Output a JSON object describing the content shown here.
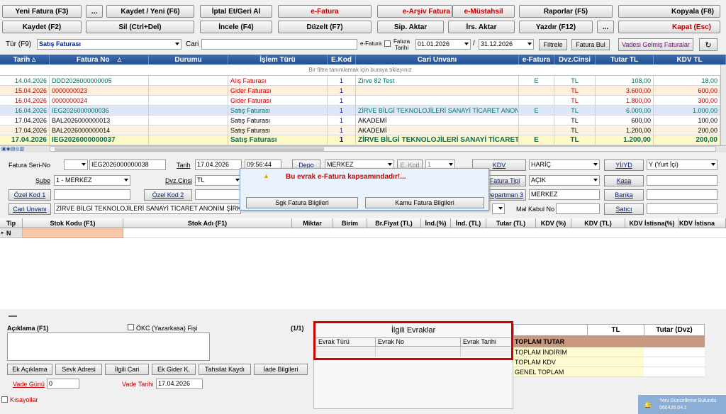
{
  "toolbar": {
    "row1": [
      "Yeni Fatura (F3)",
      "...",
      "Kaydet / Yeni (F6)",
      "İptal Et/Geri Al",
      "e-Fatura",
      "e-Arşiv Fatura",
      "e-Müstahsil",
      "Raporlar (F5)",
      "Kopyala (F8)"
    ],
    "row2": [
      "Kaydet (F2)",
      "Sil (Ctrl+Del)",
      "İncele (F4)",
      "Düzelt (F7)",
      "Sip. Aktar",
      "İrs. Aktar",
      "Yazdır (F12)",
      "...",
      "Kapat (Esc)"
    ]
  },
  "filter": {
    "tur_label": "Tür (F9)",
    "tur_value": "Satış Faturası",
    "cari_label": "Cari",
    "efatura_label": "e-Fatura",
    "fatura_tarihi_label_1": "Fatura",
    "fatura_tarihi_label_2": "Tarihi",
    "date_from": "01.01.2026",
    "sep": "/",
    "date_to": "31.12.2026",
    "filtrele": "Filtrele",
    "fatura_bul": "Fatura Bul",
    "vadesi_gelmis": "Vadesi Gelmiş Faturalar",
    "refresh": "↻"
  },
  "grid": {
    "headers": [
      "Tarih",
      "Fatura No",
      "Durumu",
      "İşlem Türü",
      "E.Kod",
      "Cari Unvanı",
      "e-Fatura",
      "Dvz.Cinsi",
      "Tutar TL",
      "KDV TL"
    ],
    "filter_hint": "Bir filtre tanımlamak için buraya tıklayınız",
    "rows": [
      {
        "tarih": "14.04.2026",
        "no": "DDD2026000000005",
        "durum": "",
        "islem": "Alış Faturası",
        "ekod": "1",
        "cari": "Zirve 82 Test",
        "efat": "E",
        "dvz": "TL",
        "tutar": "108,00",
        "kdv": "18,00"
      },
      {
        "tarih": "15.04.2026",
        "no": "0000000023",
        "durum": "",
        "islem": "Gider Faturası",
        "ekod": "1",
        "cari": "",
        "efat": "",
        "dvz": "TL",
        "tutar": "3.600,00",
        "kdv": "600,00"
      },
      {
        "tarih": "16.04.2026",
        "no": "0000000024",
        "durum": "",
        "islem": "Gider Faturası",
        "ekod": "1",
        "cari": "",
        "efat": "",
        "dvz": "TL",
        "tutar": "1.800,00",
        "kdv": "300,00"
      },
      {
        "tarih": "16.04.2026",
        "no": "IEG2026000000036",
        "durum": "",
        "islem": "Satış Faturası",
        "ekod": "1",
        "cari": "ZİRVE BİLGİ TEKNOLOJİLERİ SANAYİ TİCARET ANONİM ŞİRKETİ",
        "efat": "E",
        "dvz": "TL",
        "tutar": "6.000,00",
        "kdv": "1.000,00"
      },
      {
        "tarih": "17.04.2026",
        "no": "BAL2026000000013",
        "durum": "",
        "islem": "Satış Faturası",
        "ekod": "1",
        "cari": "AKADEMİ",
        "efat": "",
        "dvz": "TL",
        "tutar": "600,00",
        "kdv": "100,00"
      },
      {
        "tarih": "17.04.2026",
        "no": "BAL2026000000014",
        "durum": "",
        "islem": "Satış Faturası",
        "ekod": "1",
        "cari": "AKADEMİ",
        "efat": "",
        "dvz": "TL",
        "tutar": "1.200,00",
        "kdv": "200,00"
      },
      {
        "tarih": "17.04.2026",
        "no": "IEG2026000000037",
        "durum": "",
        "islem": "Satış Faturası",
        "ekod": "1",
        "cari": "ZİRVE BİLGİ TEKNOLOJİLERİ SANAYİ TİCARET ANONİM ŞİRKETİ",
        "efat": "E",
        "dvz": "TL",
        "tutar": "1.200,00",
        "kdv": "200,00"
      }
    ]
  },
  "form": {
    "fatura_seri_no": "Fatura Seri-No",
    "seri": "",
    "no": "IEG2026000000038",
    "tarih_label": "Tarih",
    "tarih": "17.04.2026",
    "saat": "09:56:44",
    "depo_label": "Depo",
    "depo": "MERKEZ",
    "ekod_label": "E. Kod",
    "ekod": "1",
    "kdv_label": "KDV",
    "kdv": "HARİÇ",
    "yiyd_label": "Yİ/YD",
    "yiyd": "Y (Yurt İçi)",
    "sube_label": "Şube",
    "sube": "1 - MERKEZ",
    "dvz_label": "Dvz.Cinsi",
    "dvz": "TL",
    "fatura_tipi_label": "Fatura Tipi",
    "fatura_tipi": "AÇIK",
    "kasa_label": "Kasa",
    "ozel_kod1": "Özel Kod 1",
    "ozel_kod2": "Özel Kod 2",
    "departman_label": "Departman 3",
    "departman": "MERKEZ",
    "banka_label": "Banka",
    "cari_unvani_label": "Cari Unvanı",
    "cari_unvani": "ZİRVE BİLGİ TEKNOLOJİLERİ SANAYİ TİCARET ANONİM ŞİRKETİ",
    "mal_kabul_label": "Mal Kabul No",
    "satici_label": "Satıcı"
  },
  "popup": {
    "message": "Bu evrak e-Fatura kapsamındadır!...",
    "sgk": "Sgk Fatura Bilgileri",
    "kamu": "Kamu Fatura Bilgileri"
  },
  "detail": {
    "headers": [
      "Tip",
      "Stok Kodu (F1)",
      "Stok Adı (F1)",
      "Miktar",
      "Birim",
      "Br.Fiyat (TL)",
      "İnd.(%)",
      "İnd. (TL)",
      "Tutar (TL)",
      "KDV (%)",
      "KDV (TL)",
      "KDV İstisna(%)",
      "KDV İstisna"
    ],
    "first_row_tip": "N"
  },
  "bottom": {
    "aciklama": "Açıklama (F1)",
    "okc": "ÖKC (Yazarkasa) Fişi",
    "page": "(1/1)",
    "buttons": [
      "Ek Açıklama",
      "Sevk Adresi",
      "İlgili Cari",
      "Ek Gider K.",
      "Tahsilat Kaydı",
      "İade Bilgileri"
    ],
    "vade_gunu_label": "Vade Günü",
    "vade_gunu": "0",
    "vade_tarihi_label": "Vade Tarihi",
    "vade_tarihi": "17.04.2026",
    "kisayollar": "Kısayollar"
  },
  "ilgili": {
    "title": "İlgili Evraklar",
    "headers": [
      "Evrak Türü",
      "Evrak No",
      "Evrak Tarihi"
    ]
  },
  "totals": {
    "headers": [
      "",
      "TL",
      "Tutar (Dvz)"
    ],
    "rows": [
      "TOPLAM TUTAR",
      "TOPLAM İNDİRİM",
      "TOPLAM KDV",
      "GENEL TOPLAM"
    ]
  },
  "notification": {
    "line1": "Yeni Güncelleme Bulundu",
    "line2": "060426.04.1"
  }
}
